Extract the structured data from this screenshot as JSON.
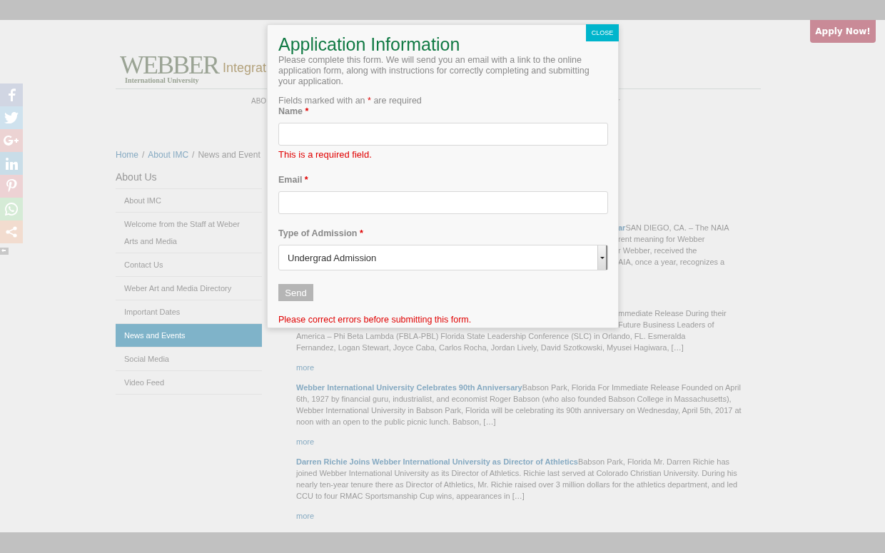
{
  "apply_button": "Apply Now!",
  "logo": {
    "name": "WEBBER",
    "subtitle": "International University"
  },
  "header": {
    "tagline": "Integrat"
  },
  "nav": {
    "items": [
      "ABO"
    ]
  },
  "breadcrumb": [
    {
      "kind": "link",
      "label": "Home"
    },
    {
      "kind": "separator",
      "label": "/"
    },
    {
      "kind": "link",
      "label": "About IMC"
    },
    {
      "kind": "separator",
      "label": "/"
    },
    {
      "kind": "current",
      "label": "News and Event"
    }
  ],
  "sidebar": {
    "title": "About Us",
    "items": [
      {
        "label": "About IMC",
        "selected": false
      },
      {
        "label": "Welcome from the Staff at Weber Arts and Media",
        "selected": false
      },
      {
        "label": "Contact Us",
        "selected": false
      },
      {
        "label": "Weber Art and Media Directory",
        "selected": false
      },
      {
        "label": "Important Dates",
        "selected": false
      },
      {
        "label": "News and Events",
        "selected": true
      },
      {
        "label": "Social Media",
        "selected": false
      },
      {
        "label": "Video Feed",
        "selected": false
      }
    ]
  },
  "news": [
    {
      "lines": [
        {
          "text": "**ar**SAN DIEGO, CA. – The NAIA",
          "clipped": true
        },
        {
          "text": "rent meaning for Webber",
          "clipped": true
        },
        {
          "text": "r Webber, received the",
          "clipped": true
        },
        {
          "text": "AIA, once a year, recognizes a",
          "clipped": true
        }
      ]
    },
    {
      "lines": [
        {
          "text": "mmediate Release During their",
          "clipped": true
        },
        {
          "text": "Future Business Leaders of",
          "clipped": true
        },
        {
          "text": "America – Phi Beta Lambda (FBLA-PBL) Florida State Leadership Conference (SLC) in Orlando, FL. Esmeralda",
          "clipped": false
        },
        {
          "text": "Fernandez, Logan Stewart, Joyce Caba, Carlos Rocha, Jordan Lively, David Szotkowski, Myusei Hagiwara, […]",
          "clipped": false
        }
      ],
      "more": "more"
    },
    {
      "title": "Webber International University Celebrates 90th Anniversary",
      "body": "Babson Park, Florida For Immediate Release Founded on April 6th, 1927 by financial guru, industrialist, and economist Roger Babson (who also founded Babson College in Massachusetts), Webber International University in Babson Park, Florida will be celebrating its 90th anniversary on Wednesday, April 5th, 2017 at noon with an open to the public picnic lunch. Babson, […]",
      "more": "more"
    },
    {
      "title": "Darren Richie Joins Webber International University as Director of Athletics",
      "body": "Babson Park, Florida Mr. Darren Richie has joined Webber International University as its Director of Athletics. Richie last served at Colorado Christian University. During his nearly ten-year tenure there as Director of Athletics, Mr. Richie raised over 3 million dollars for the athletics department, and led CCU to four RMAC Sportsmanship Cup wins, appearances in […]",
      "more": "more"
    }
  ],
  "modal": {
    "close": "CLOSE",
    "title": "Application Information",
    "intro": "Please complete this form.  We will send you an email with a link to the online application form, along with instructions for correctly completing and submitting your application.",
    "required_note": "Fields marked with an * are required",
    "fields": [
      {
        "kind": "text",
        "label": "Name",
        "required_mark": "*",
        "error": "This is a required field."
      },
      {
        "kind": "text",
        "label": "Email",
        "required_mark": "*"
      },
      {
        "kind": "select",
        "label": "Type of Admission",
        "required_mark": "*",
        "value": "Undergrad Admission"
      }
    ],
    "send": {
      "label": "Send",
      "disabled": true
    },
    "form_error": "Please correct errors before submitting this form."
  }
}
